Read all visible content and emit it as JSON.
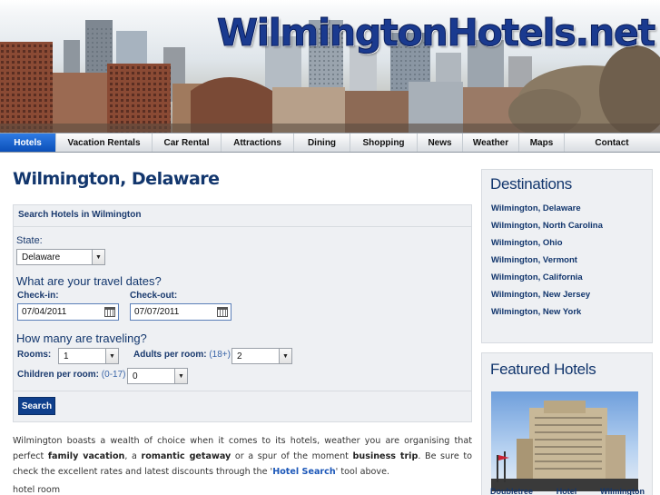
{
  "site": {
    "title": "WilmingtonHotels.net"
  },
  "nav": {
    "items": [
      "Hotels",
      "Vacation Rentals",
      "Car Rental",
      "Attractions",
      "Dining",
      "Shopping",
      "News",
      "Weather",
      "Maps",
      "Contact"
    ]
  },
  "main": {
    "title": "Wilmington, Delaware",
    "search": {
      "heading": "Search Hotels in Wilmington",
      "state_label": "State:",
      "state_value": "Delaware",
      "dates_heading": "What are your travel dates?",
      "checkin_label": "Check-in:",
      "checkin_value": "07/04/2011",
      "checkout_label": "Check-out:",
      "checkout_value": "07/07/2011",
      "travelers_heading": "How many are traveling?",
      "rooms_label": "Rooms:",
      "rooms_value": "1",
      "adults_label": "Adults per room:",
      "adults_hint": "(18+)",
      "adults_value": "2",
      "children_label": "Children per room:",
      "children_hint": "(0-17)",
      "children_value": "0",
      "button": "Search"
    },
    "intro": {
      "p1": "Wilmington boasts a wealth of choice when it comes to its hotels, weather you are organising that perfect ",
      "b1": "family vacation",
      "p2": ", a ",
      "b2": "romantic getaway",
      "p3": " or a spur of the moment ",
      "b3": "business trip",
      "p4": ". Be sure to check the excellent rates and latest discounts through the '",
      "link": "Hotel Search",
      "p5": "' tool above."
    },
    "hotel_room": "hotel room"
  },
  "sidebar": {
    "destinations_title": "Destinations",
    "destinations": [
      "Wilmington, Delaware",
      "Wilmington, North Carolina",
      "Wilmington, Ohio",
      "Wilmington, Vermont",
      "Wilmington, California",
      "Wilmington, New Jersey",
      "Wilmington, New York"
    ],
    "featured_title": "Featured Hotels",
    "featured_caption": [
      "Doubletree",
      "Hotel",
      "Wilmington"
    ]
  },
  "colors": {
    "brand": "#12366d",
    "nav_active": "#0b4fb8",
    "button": "#0f3f8c"
  }
}
